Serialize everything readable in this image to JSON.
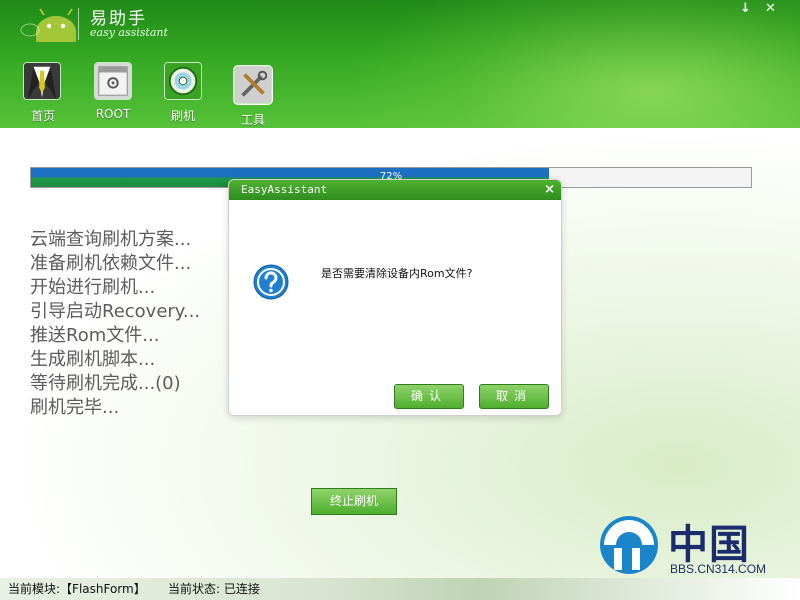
{
  "header": {
    "brand_title": "易助手",
    "brand_subtitle": "easy assistant",
    "window_controls": {
      "minimize": "↓",
      "close": "✕"
    }
  },
  "nav": [
    {
      "label": "首页",
      "icon": "home-suit-icon"
    },
    {
      "label": "ROOT",
      "icon": "root-gear-icon"
    },
    {
      "label": "刷机",
      "icon": "flash-disc-icon"
    },
    {
      "label": "工具",
      "icon": "tools-icon"
    }
  ],
  "progress": {
    "percent": 72,
    "text": "72%"
  },
  "steps": [
    "云端查询刷机方案...",
    "准备刷机依赖文件...",
    "开始进行刷机...",
    "引导启动Recovery...",
    "推送Rom文件...",
    "生成刷机脚本...",
    "等待刷机完成...(0)",
    "刷机完毕..."
  ],
  "stop_button": "终止刷机",
  "watermark": {
    "title": "中国派",
    "url": "BBS.CN314.COM"
  },
  "statusbar": {
    "module": "当前模块:【FlashForm】",
    "state": "当前状态: 已连接"
  },
  "dialog": {
    "title": "EasyAssistant",
    "close": "×",
    "message": "是否需要清除设备内Rom文件?",
    "confirm": "确认",
    "cancel": "取消"
  },
  "colors": {
    "accent": "#3aa324",
    "progress_blue": "#1d6fc2",
    "text_gray": "#5c5c5c"
  }
}
